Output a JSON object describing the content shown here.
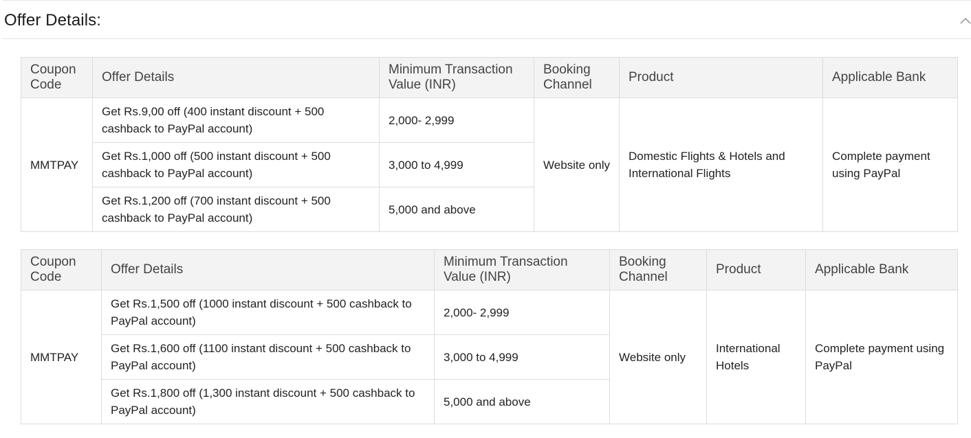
{
  "section": {
    "title": "Offer Details:",
    "collapse_icon": "chevron-up-icon"
  },
  "tables": [
    {
      "headers": [
        "Coupon Code",
        "Offer Details",
        "Minimum Transaction Value (INR)",
        "Booking Channel",
        "Product",
        "Applicable Bank"
      ],
      "coupon": "MMTPAY",
      "rows": [
        {
          "offer": "Get Rs.9,00 off (400 instant discount + 500 cashback to PayPal account)",
          "min_value": "2,000- 2,999"
        },
        {
          "offer": "Get Rs.1,000 off (500 instant discount + 500 cashback to PayPal account)",
          "min_value": "3,000 to 4,999"
        },
        {
          "offer": "Get Rs.1,200 off (700 instant discount + 500 cashback to PayPal account)",
          "min_value": "5,000 and above"
        }
      ],
      "channel": "Website only",
      "product": "Domestic Flights & Hotels and International Flights",
      "bank": "Complete payment using PayPal"
    },
    {
      "headers": [
        "Coupon Code",
        "Offer Details",
        "Minimum Transaction Value (INR)",
        "Booking Channel",
        "Product",
        "Applicable Bank"
      ],
      "coupon": "MMTPAY",
      "rows": [
        {
          "offer": "Get Rs.1,500 off (1000 instant discount + 500 cashback to PayPal account)",
          "min_value": "2,000- 2,999"
        },
        {
          "offer": "Get Rs.1,600 off (1100 instant discount + 500 cashback to PayPal account)",
          "min_value": "3,000 to 4,999"
        },
        {
          "offer": "Get Rs.1,800 off (1,300 instant discount + 500 cashback to PayPal account)",
          "min_value": "5,000 and above"
        }
      ],
      "channel": "Website only",
      "product": "International Hotels",
      "bank": "Complete payment using PayPal"
    }
  ],
  "colors": {
    "coupon_text": "#2e8b3a",
    "header_bg": "#f3f3f3",
    "border": "#dcdcdc"
  }
}
